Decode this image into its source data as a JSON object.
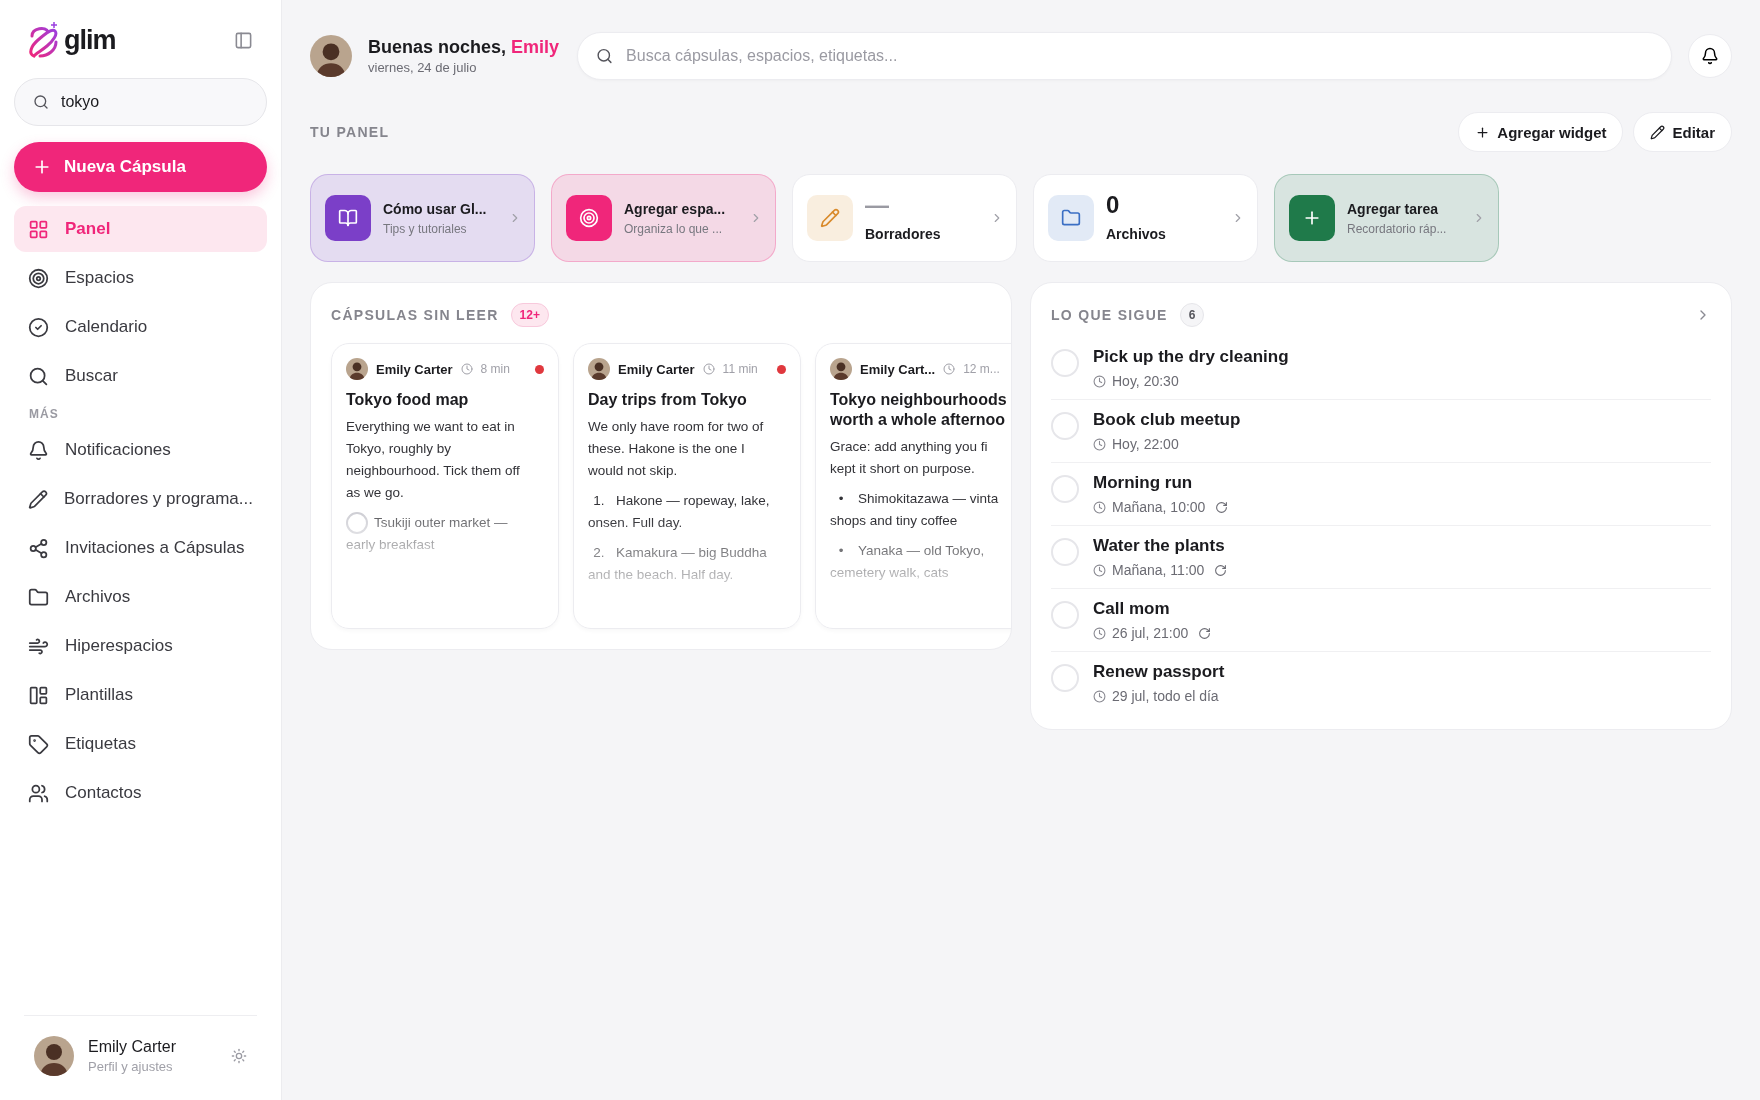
{
  "sidebar": {
    "brand": "glim",
    "search": {
      "value": "tokyo"
    },
    "new_button": "Nueva Cápsula",
    "items": [
      {
        "label": "Panel",
        "selected": true
      },
      {
        "label": "Espacios",
        "selected": false
      },
      {
        "label": "Calendario",
        "selected": false
      },
      {
        "label": "Buscar",
        "selected": false
      }
    ],
    "section_label": "MÁS",
    "more_items": [
      {
        "label": "Notificaciones",
        "selected": false
      },
      {
        "label": "Borradores y programa...",
        "selected": false
      },
      {
        "label": "Invitaciones a Cápsulas",
        "selected": false
      },
      {
        "label": "Archivos",
        "selected": false
      },
      {
        "label": "Hiperespacios",
        "selected": false
      },
      {
        "label": "Plantillas",
        "selected": false
      },
      {
        "label": "Etiquetas",
        "selected": false
      },
      {
        "label": "Contactos",
        "selected": false
      }
    ],
    "profile": {
      "name": "Emily Carter",
      "subtitle": "Perfil y ajustes"
    }
  },
  "header": {
    "greeting": "Buenas noches,",
    "name": "Emily",
    "date": "viernes, 24 de julio",
    "search": {
      "placeholder": "Busca cápsulas, espacios, etiquetas..."
    }
  },
  "panel": {
    "title": "TU PANEL",
    "actions": [
      "Agregar widget",
      "Editar"
    ],
    "widgets": [
      {
        "kind": "link",
        "color": "#7b3fc8",
        "title": "Cómo usar Gl...",
        "subtitle": "Tips y tutoriales"
      },
      {
        "kind": "link",
        "color": "#f0267a",
        "title": "Agregar espa...",
        "subtitle": "Organiza lo que ..."
      },
      {
        "kind": "stat",
        "color": "#d98a2b",
        "value": "—",
        "title": "Borradores"
      },
      {
        "kind": "stat",
        "color": "#3b6fc4",
        "value": "0",
        "title": "Archivos"
      },
      {
        "kind": "link",
        "color": "#1f7a4a",
        "title": "Agregar tarea",
        "subtitle": "Recordatorio ráp..."
      }
    ]
  },
  "unread": {
    "title": "CÁPSULAS SIN LEER",
    "badge": "12+",
    "capsules": [
      {
        "author": "Emily Carter",
        "time": "8 min",
        "unread": true,
        "title_lines": [
          "Tokyo food map"
        ],
        "body_lines": [
          "Everything we want to eat in",
          "Tokyo, roughly by",
          "neighbourhood. Tick them off",
          "as we go."
        ],
        "items": [
          {
            "kind": "check",
            "checked": false,
            "lines": [
              "Tsukiji outer market —",
              "early breakfast"
            ]
          }
        ]
      },
      {
        "author": "Emily Carter",
        "time": "11 min",
        "unread": true,
        "title_lines": [
          "Day trips from Tokyo"
        ],
        "body_lines": [
          "We only have room for two of",
          "these. Hakone is the one I",
          "would not skip."
        ],
        "items": [
          {
            "kind": "numbered",
            "marker": "1.",
            "lines": [
              "Hakone — ropeway, lake,",
              "onsen. Full day."
            ]
          },
          {
            "kind": "numbered",
            "marker": "2.",
            "lines": [
              "Kamakura — big Buddha",
              "and the beach. Half day."
            ]
          }
        ]
      },
      {
        "author": "Emily Cart...",
        "time": "12 m...",
        "title_lines": [
          "Tokyo neighbourhoods",
          "worth a whole afternoo"
        ],
        "body_lines": [
          "Grace: add anything you fi",
          "kept it short on purpose."
        ],
        "items": [
          {
            "kind": "bullet",
            "marker": "•",
            "lines": [
              "Shimokitazawa — vinta",
              "shops and tiny coffee"
            ]
          },
          {
            "kind": "bullet",
            "marker": "•",
            "lines": [
              "Yanaka — old Tokyo,",
              "cemetery walk, cats"
            ]
          }
        ]
      }
    ]
  },
  "next": {
    "title": "LO QUE SIGUE",
    "count": "6",
    "tasks": [
      {
        "title": "Pick up the dry cleaning",
        "when": "Hoy, 20:30",
        "repeating": false,
        "checked": false
      },
      {
        "title": "Book club meetup",
        "when": "Hoy, 22:00",
        "repeating": false,
        "checked": false
      },
      {
        "title": "Morning run",
        "when": "Mañana, 10:00",
        "repeating": true,
        "checked": false
      },
      {
        "title": "Water the plants",
        "when": "Mañana, 11:00",
        "repeating": true,
        "checked": false
      },
      {
        "title": "Call mom",
        "when": "26 jul, 21:00",
        "repeating": true,
        "checked": false
      },
      {
        "title": "Renew passport",
        "when": "29 jul, todo el día",
        "repeating": false,
        "checked": false
      }
    ]
  }
}
